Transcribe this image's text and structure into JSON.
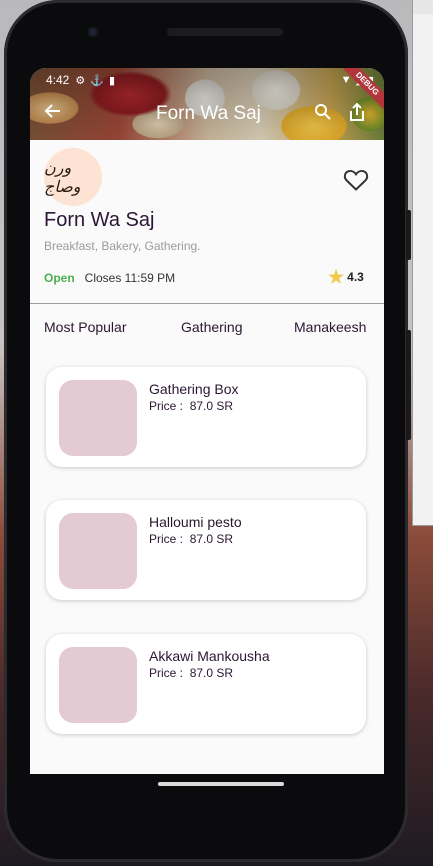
{
  "status_bar": {
    "time": "4:42"
  },
  "app_bar": {
    "title": "Forn Wa Saj",
    "debug_badge": "DEBUG"
  },
  "restaurant": {
    "logo_text": "ورن وصاج",
    "name": "Forn Wa Saj",
    "categories": "Breakfast, Bakery, Gathering.",
    "status": "Open",
    "closes": "Closes 11:59 PM",
    "rating": "4.3"
  },
  "tabs": [
    "Most Popular",
    "Gathering",
    "Manakeesh"
  ],
  "menu_items": [
    {
      "name": "Gathering Box",
      "price_label": "Price :",
      "price": "87.0 SR"
    },
    {
      "name": "Halloumi pesto",
      "price_label": "Price :",
      "price": "87.0 SR"
    },
    {
      "name": "Akkawi Mankousha",
      "price_label": "Price :",
      "price": "87.0 SR"
    }
  ],
  "colors": {
    "accent_text": "#2b1633",
    "open_green": "#4caf50",
    "star": "#f2c94c",
    "thumb_placeholder": "#e3cad3"
  }
}
